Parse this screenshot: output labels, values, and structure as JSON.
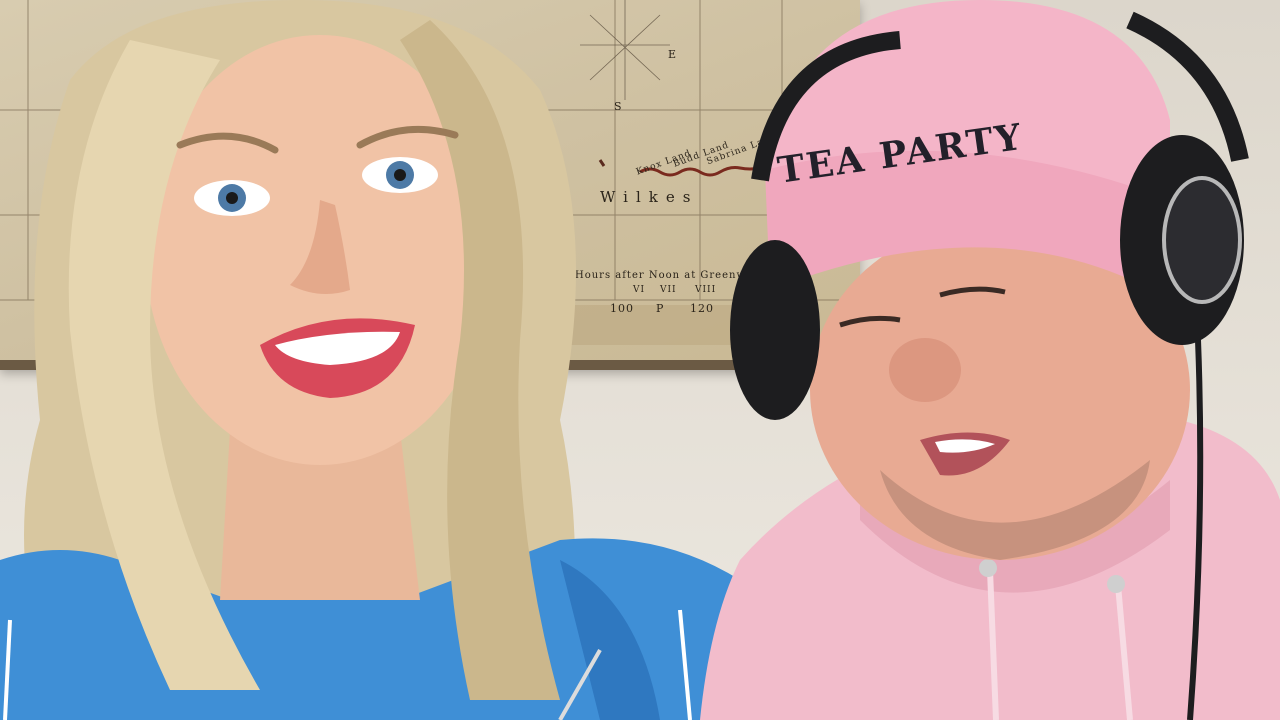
{
  "scene": {
    "description_elements": [
      "woman-portrait",
      "man-portrait",
      "antique-map"
    ]
  },
  "map": {
    "labels": [
      "Wilkes",
      "Hours after Noon at Greenwich",
      "100",
      "P",
      "120",
      "VI",
      "VII",
      "VIII",
      "E",
      "S",
      "Knox Land",
      "Budd Land",
      "Sabrina Land"
    ]
  },
  "man": {
    "beanie_text": "TEA PARTY"
  },
  "colors": {
    "woman_hoodie": "#3f8fd6",
    "man_hoodie": "#f2bccb",
    "beanie": "#f4b5c8",
    "headphones": "#1d1d1f",
    "lips": "#d8495a"
  }
}
